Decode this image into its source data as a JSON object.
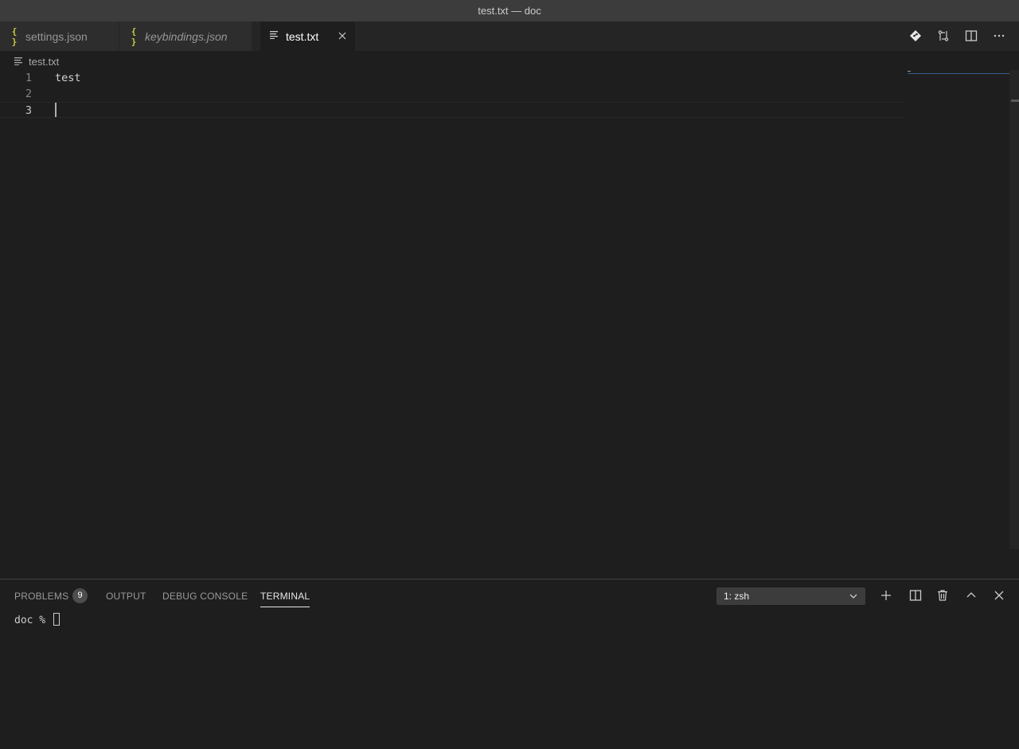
{
  "window": {
    "title": "test.txt — doc"
  },
  "tabs": [
    {
      "label": "settings.json",
      "icon": "json-braces-icon",
      "active": false,
      "italic": false
    },
    {
      "label": "keybindings.json",
      "icon": "json-braces-icon",
      "active": false,
      "italic": true
    },
    {
      "label": "test.txt",
      "icon": "text-file-icon",
      "active": true,
      "italic": false
    }
  ],
  "tab_icon_glyphs": {
    "json": "{ }"
  },
  "editor_actions": [
    "git-diamond-icon",
    "compare-changes-icon",
    "split-editor-icon",
    "more-actions-icon"
  ],
  "breadcrumb": {
    "file": "test.txt"
  },
  "editor": {
    "lines": [
      {
        "number": "1",
        "text": "test"
      },
      {
        "number": "2",
        "text": ""
      },
      {
        "number": "3",
        "text": ""
      }
    ],
    "cursor_line": 3
  },
  "panel": {
    "tabs": {
      "problems": "PROBLEMS",
      "problems_count": "9",
      "output": "OUTPUT",
      "debug_console": "DEBUG CONSOLE",
      "terminal": "TERMINAL"
    },
    "active_tab": "TERMINAL",
    "terminal_selector": "1: zsh",
    "actions": [
      "plus-icon",
      "split-terminal-icon",
      "trash-icon",
      "chevron-up-icon",
      "close-icon"
    ],
    "terminal_prompt": "doc % "
  },
  "colors": {
    "editor_background": "#1e1e1e",
    "titlebar": "#3c3c3c",
    "tab_inactive": "#2d2d2d",
    "json_icon": "#cbcb41",
    "line_number": "#858585"
  }
}
